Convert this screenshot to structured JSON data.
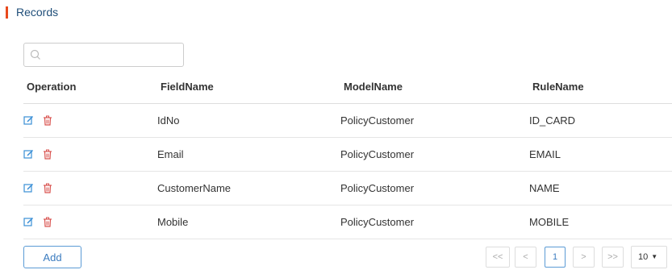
{
  "header": {
    "title": "Records"
  },
  "search": {
    "value": "",
    "placeholder": ""
  },
  "table": {
    "columns": [
      "Operation",
      "FieldName",
      "ModelName",
      "RuleName"
    ],
    "rows": [
      {
        "field": "IdNo",
        "model": "PolicyCustomer",
        "rule": "ID_CARD"
      },
      {
        "field": "Email",
        "model": "PolicyCustomer",
        "rule": "EMAIL"
      },
      {
        "field": "CustomerName",
        "model": "PolicyCustomer",
        "rule": "NAME"
      },
      {
        "field": "Mobile",
        "model": "PolicyCustomer",
        "rule": "MOBILE"
      }
    ],
    "row_icons": [
      "edit-icon",
      "delete-icon"
    ]
  },
  "actions": {
    "add_label": "Add"
  },
  "pagination": {
    "first": "<<",
    "prev": "<",
    "current": "1",
    "next": ">",
    "last": ">>",
    "page_size": "10",
    "page_size_caret": "▼"
  },
  "colors": {
    "accent": "#e8491d",
    "title": "#1f4e79",
    "edit_icon": "#3a8fd6",
    "delete_icon": "#d9534f",
    "primary_border": "#5b9bd5"
  }
}
